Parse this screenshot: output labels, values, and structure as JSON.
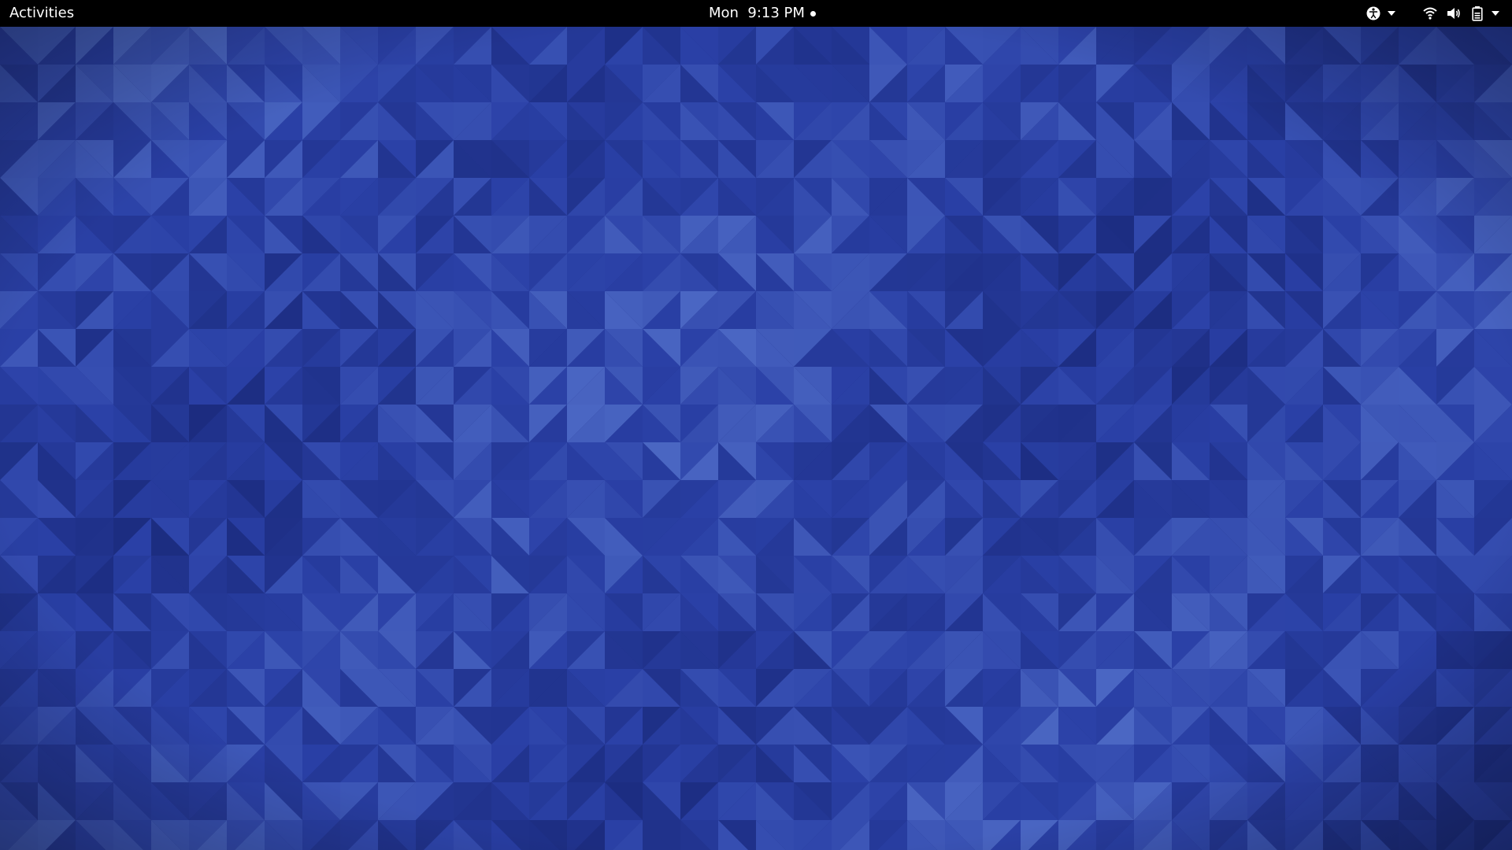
{
  "topbar": {
    "activities_label": "Activities",
    "clock_text": "Mon  9:13 PM",
    "notification_indicator": true,
    "tray": {
      "accessibility_icon": "accessibility-icon",
      "wifi_icon": "wifi-icon",
      "volume_icon": "volume-icon",
      "battery_icon": "battery-icon"
    }
  },
  "desktop": {
    "wallpaper": "blue low-poly triangle pattern",
    "colors": {
      "base": "#2a40a6",
      "dark": "#1a2a7c",
      "light": "#4f6cc7",
      "panel": "#000000"
    }
  }
}
